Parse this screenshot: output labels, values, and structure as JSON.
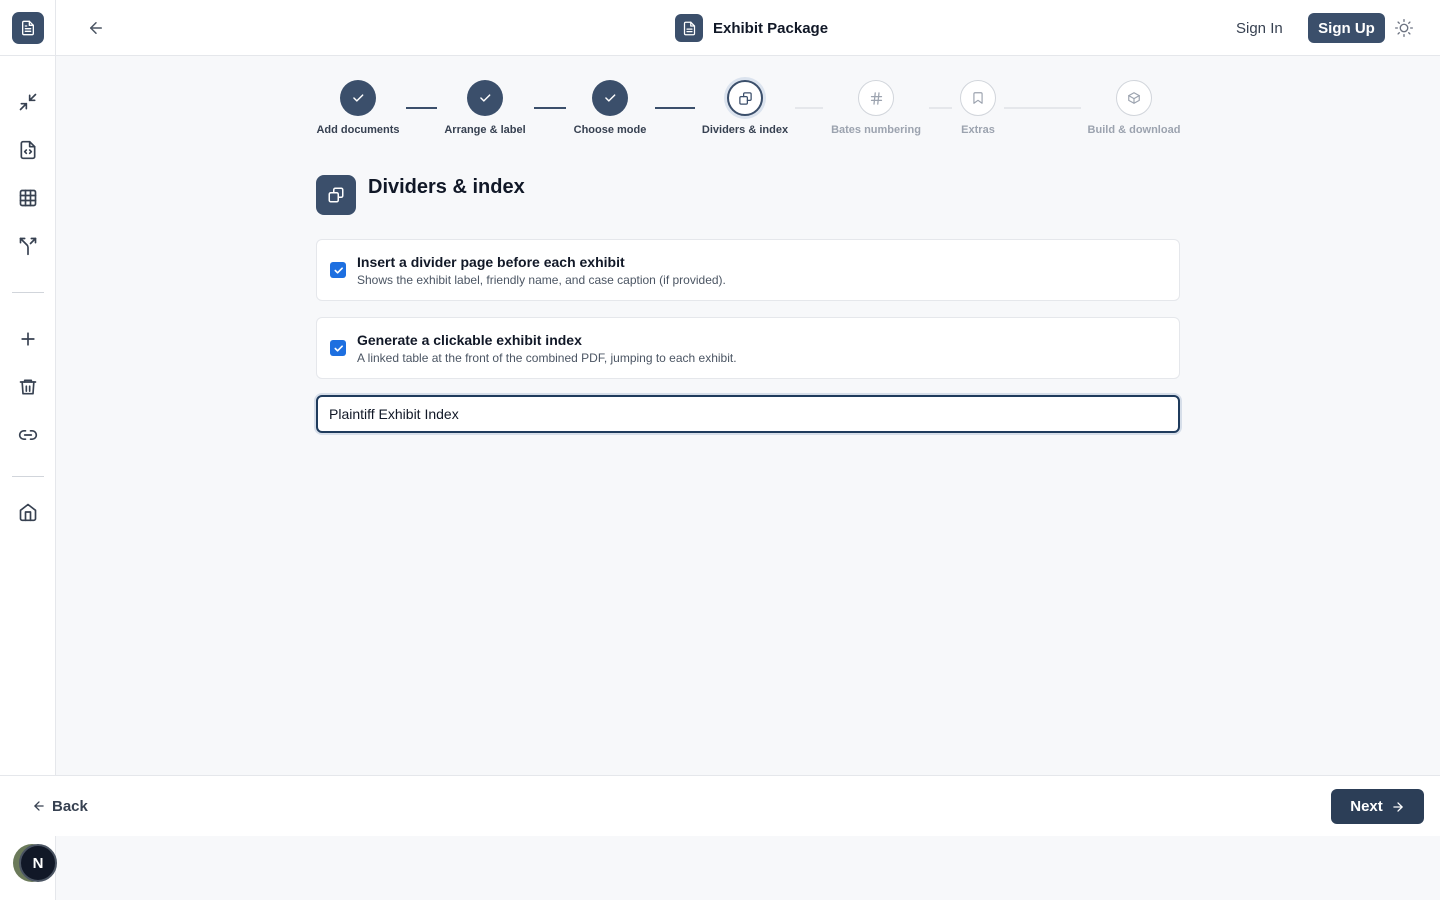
{
  "header": {
    "title": "Exhibit Package",
    "sign_in_label": "Sign In",
    "sign_up_label": "Sign Up"
  },
  "stepper": {
    "steps": [
      {
        "label": "Add documents",
        "state": "done"
      },
      {
        "label": "Arrange & label",
        "state": "done"
      },
      {
        "label": "Choose mode",
        "state": "done"
      },
      {
        "label": "Dividers & index",
        "state": "current"
      },
      {
        "label": "Bates numbering",
        "state": "todo"
      },
      {
        "label": "Extras",
        "state": "todo"
      },
      {
        "label": "Build & download",
        "state": "todo"
      }
    ]
  },
  "section": {
    "title": "Dividers & index"
  },
  "options": [
    {
      "title": "Insert a divider page before each exhibit",
      "description": "Shows the exhibit label, friendly name, and case caption (if provided).",
      "checked": true
    },
    {
      "title": "Generate a clickable exhibit index",
      "description": "A linked table at the front of the combined PDF, jumping to each exhibit.",
      "checked": true
    }
  ],
  "index_title_input": {
    "value": "Plaintiff Exhibit Index"
  },
  "footer": {
    "back_label": "Back",
    "next_label": "Next"
  },
  "user": {
    "avatar_initial": "N"
  },
  "colors": {
    "primary": "#3b4f6b",
    "checkbox": "#1d6fe0"
  }
}
